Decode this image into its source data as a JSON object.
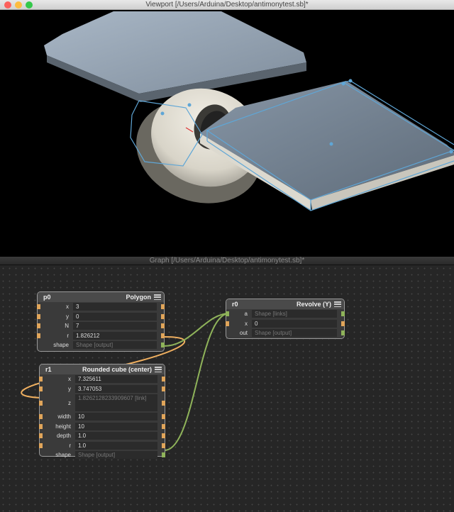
{
  "windows": {
    "viewport_title": "Viewport [/Users/Arduina/Desktop/antimonytest.sb]*",
    "graph_title": "Graph [/Users/Arduina/Desktop/antimonytest.sb]*"
  },
  "colors": {
    "close": "#fc605c",
    "minimize": "#fdbc40",
    "zoom": "#34c84a",
    "wire_orange": "#f0b060",
    "wire_green": "#8fb35a"
  },
  "nodes": {
    "p0": {
      "id": "p0",
      "kind": "Polygon",
      "fields": [
        {
          "label": "x",
          "value": "3"
        },
        {
          "label": "y",
          "value": "0"
        },
        {
          "label": "N",
          "value": "7"
        },
        {
          "label": "r",
          "value": "1.826212"
        },
        {
          "label": "shape",
          "value": "Shape [output]"
        }
      ]
    },
    "r1": {
      "id": "r1",
      "kind": "Rounded cube (center)",
      "fields": [
        {
          "label": "x",
          "value": "7.325611"
        },
        {
          "label": "y",
          "value": "3.747053"
        },
        {
          "label": "z",
          "value": "1.8262128233909607 [link]"
        },
        {
          "label": "width",
          "value": "10"
        },
        {
          "label": "height",
          "value": "10"
        },
        {
          "label": "depth",
          "value": "1.0"
        },
        {
          "label": "r",
          "value": "1.0"
        },
        {
          "label": "shape",
          "value": "Shape [output]"
        }
      ]
    },
    "r0": {
      "id": "r0",
      "kind": "Revolve (Y)",
      "fields": [
        {
          "label": "a",
          "value": "Shape [links]"
        },
        {
          "label": "x",
          "value": "0"
        },
        {
          "label": "out",
          "value": "Shape [output]"
        }
      ]
    }
  }
}
